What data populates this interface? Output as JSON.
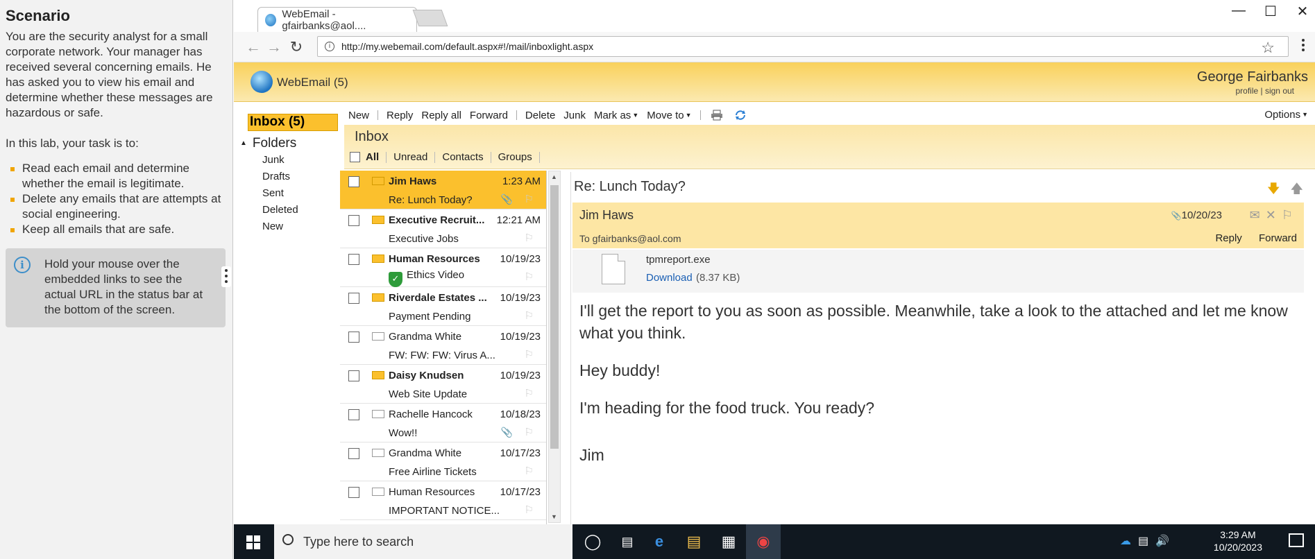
{
  "scenario": {
    "title": "Scenario",
    "intro": "You are the security analyst for a small corporate network. Your manager has received several concerning emails. He has asked you to view his email and determine whether these messages are hazardous or safe.",
    "task_intro": "In this lab, your task is to:",
    "tasks": [
      "Read each email and determine whether the email is legitimate.",
      "Delete any emails that are attempts at social engineering.",
      "Keep all emails that are safe."
    ],
    "tip": "Hold your mouse over the embedded links to see the actual URL in the status bar at the bottom of the screen."
  },
  "browser": {
    "tab_title": "WebEmail - gfairbanks@aol....",
    "url": "http://my.webemail.com/default.aspx#!/mail/inboxlight.aspx"
  },
  "app": {
    "brand": "WebEmail (5)",
    "user_name": "George Fairbanks",
    "user_links": "profile | sign out"
  },
  "toolbar": {
    "new": "New",
    "reply": "Reply",
    "reply_all": "Reply all",
    "forward": "Forward",
    "delete": "Delete",
    "junk": "Junk",
    "mark_as": "Mark as",
    "move_to": "Move to",
    "options": "Options"
  },
  "nav": {
    "inbox": "Inbox (5)",
    "folders_label": "Folders",
    "folders": [
      "Junk",
      "Drafts",
      "Sent",
      "Deleted",
      "New"
    ]
  },
  "inbox": {
    "title": "Inbox",
    "filters": [
      "All",
      "Unread",
      "Contacts",
      "Groups"
    ]
  },
  "messages": [
    {
      "from": "Jim Haws",
      "date": "1:23 AM",
      "subject": "Re: Lunch Today?",
      "unread": true,
      "selected": true,
      "attachment": true
    },
    {
      "from": "Executive Recruit...",
      "date": "12:21 AM",
      "subject": "Executive Jobs",
      "unread": true,
      "selected": false,
      "attachment": false
    },
    {
      "from": "Human Resources",
      "date": "10/19/23",
      "subject": "Ethics Video",
      "unread": true,
      "selected": false,
      "attachment": false,
      "shield": true
    },
    {
      "from": "Riverdale Estates ...",
      "date": "10/19/23",
      "subject": "Payment Pending",
      "unread": true,
      "selected": false,
      "attachment": false
    },
    {
      "from": "Grandma White",
      "date": "10/19/23",
      "subject": "FW: FW: FW: Virus A...",
      "unread": false,
      "selected": false,
      "attachment": false
    },
    {
      "from": "Daisy Knudsen",
      "date": "10/19/23",
      "subject": "Web Site Update",
      "unread": true,
      "selected": false,
      "attachment": false
    },
    {
      "from": "Rachelle Hancock",
      "date": "10/18/23",
      "subject": "Wow!!",
      "unread": false,
      "selected": false,
      "attachment": true
    },
    {
      "from": "Grandma White",
      "date": "10/17/23",
      "subject": "Free Airline Tickets",
      "unread": false,
      "selected": false,
      "attachment": false
    },
    {
      "from": "Human Resources",
      "date": "10/17/23",
      "subject": "IMPORTANT NOTICE...",
      "unread": false,
      "selected": false,
      "attachment": false
    }
  ],
  "reading": {
    "subject": "Re: Lunch Today?",
    "sender": "Jim Haws",
    "date": "10/20/23",
    "to": "To gfairbanks@aol.com",
    "reply": "Reply",
    "forward": "Forward",
    "attachment_name": "tpmreport.exe",
    "download": "Download",
    "attachment_size": "(8.37 KB)",
    "body": [
      "I'll get the report to you as soon as possible. Meanwhile, take a look to the attached and let me know what you think.",
      "Hey buddy!",
      "I'm heading for the food truck. You ready?"
    ],
    "signature": "Jim"
  },
  "taskbar": {
    "search_placeholder": "Type here to search",
    "time": "3:29 AM",
    "date": "10/20/2023"
  }
}
